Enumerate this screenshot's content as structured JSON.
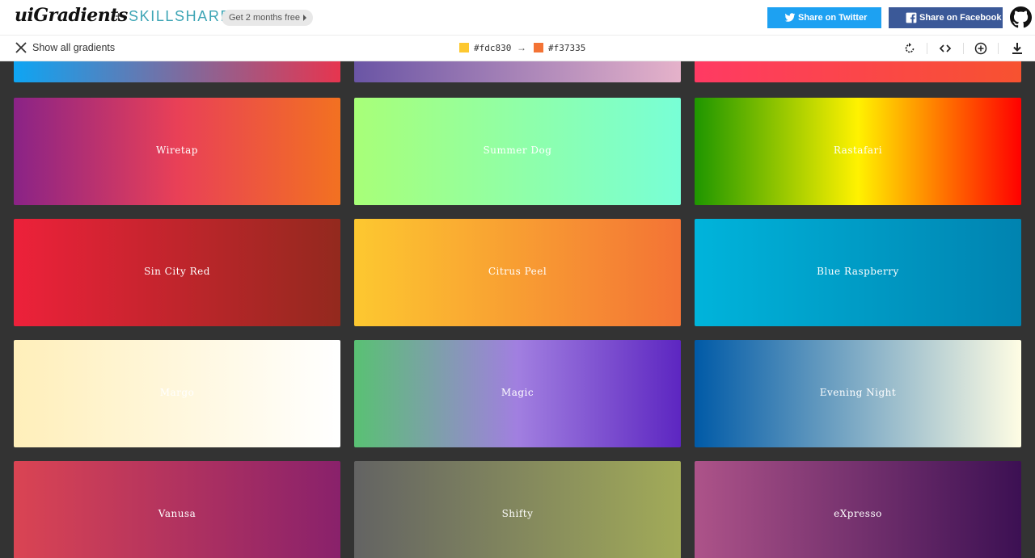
{
  "header": {
    "logo": "uiGradients",
    "plus": "+",
    "partner": "SKILLSHARE",
    "promo": "Get 2 months free",
    "twitter_label": "Share on Twitter",
    "facebook_label": "Share on Facebook",
    "colors": {
      "twitter": "#1da1f2",
      "facebook": "#3b5998"
    }
  },
  "toolbar": {
    "show_all": "Show all gradients",
    "color_from": "#fdc830",
    "arrow": "→",
    "color_to": "#f37335",
    "tools": [
      "rotate-icon",
      "code-icon",
      "add-icon",
      "download-icon"
    ]
  },
  "gradients": [
    {
      "name": "",
      "colors": [
        "#0ea5f3",
        "#e6354f"
      ]
    },
    {
      "name": "",
      "colors": [
        "#6a55a5",
        "#e5b2ca"
      ]
    },
    {
      "name": "",
      "colors": [
        "#ff3a63",
        "#f75230"
      ]
    },
    {
      "name": "Wiretap",
      "colors": [
        "#8a2387",
        "#e94057",
        "#f27121"
      ]
    },
    {
      "name": "Summer Dog",
      "colors": [
        "#a8ff78",
        "#78ffd6"
      ]
    },
    {
      "name": "Rastafari",
      "colors": [
        "#1e9600",
        "#fff200",
        "#ff0000"
      ]
    },
    {
      "name": "Sin City Red",
      "colors": [
        "#ed213a",
        "#93291e"
      ]
    },
    {
      "name": "Citrus Peel",
      "colors": [
        "#fdc830",
        "#f37335"
      ]
    },
    {
      "name": "Blue Raspberry",
      "colors": [
        "#00b4db",
        "#0083b0"
      ]
    },
    {
      "name": "Margo",
      "colors": [
        "#ffefba",
        "#ffffff"
      ]
    },
    {
      "name": "Magic",
      "colors": [
        "#59c173",
        "#a17fe0",
        "#5d26c1"
      ]
    },
    {
      "name": "Evening Night",
      "colors": [
        "#005aa7",
        "#fffde4"
      ]
    },
    {
      "name": "Vanusa",
      "colors": [
        "#da4453",
        "#89216b"
      ]
    },
    {
      "name": "Shifty",
      "colors": [
        "#636363",
        "#a2ab58"
      ]
    },
    {
      "name": "eXpresso",
      "colors": [
        "#ad5389",
        "#3c1053"
      ]
    }
  ]
}
